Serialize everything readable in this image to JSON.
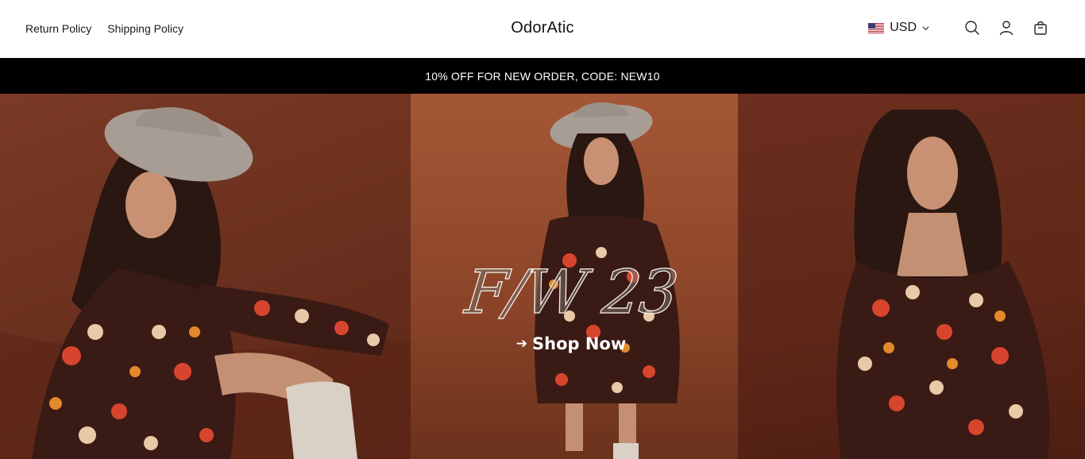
{
  "header": {
    "nav": [
      {
        "label": "Return Policy"
      },
      {
        "label": "Shipping Policy"
      }
    ],
    "brand": "OdorAtic",
    "currency": {
      "code": "USD",
      "flag_icon": "us-flag-icon"
    },
    "icons": [
      "search-icon",
      "account-icon",
      "cart-icon"
    ]
  },
  "announcement": {
    "text": "10% OFF FOR NEW ORDER, CODE: NEW10",
    "background": "#000000",
    "color": "#ffffff"
  },
  "hero": {
    "season": "F/W 23",
    "cta_arrow": "➔",
    "cta_label": "Shop Now",
    "background_tones": [
      "#6d311f",
      "#8d4529",
      "#5e2718"
    ]
  }
}
